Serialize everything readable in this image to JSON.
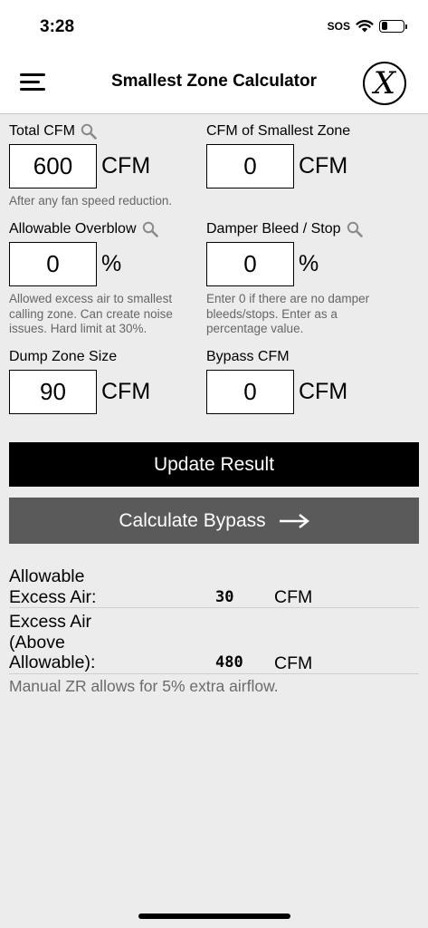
{
  "status_bar": {
    "time": "3:28",
    "sos": "SOS"
  },
  "nav": {
    "title": "Smallest Zone Calculator",
    "logo_text": "X"
  },
  "fields": {
    "total_cfm": {
      "label": "Total CFM",
      "value": "600",
      "unit": "CFM",
      "help": "After any fan speed reduction."
    },
    "smallest_zone": {
      "label": "CFM of Smallest Zone",
      "value": "0",
      "unit": "CFM"
    },
    "allowable_overblow": {
      "label": "Allowable Overblow",
      "value": "0",
      "unit": "%",
      "help": "Allowed excess air to smallest calling zone. Can create noise issues. Hard limit at 30%."
    },
    "damper_bleed": {
      "label": "Damper Bleed / Stop",
      "value": "0",
      "unit": "%",
      "help": "Enter 0 if there are no damper bleeds/stops. Enter as a percentage value."
    },
    "dump_zone": {
      "label": "Dump Zone Size",
      "value": "90",
      "unit": "CFM"
    },
    "bypass_cfm": {
      "label": "Bypass CFM",
      "value": "0",
      "unit": "CFM"
    }
  },
  "buttons": {
    "update": "Update Result",
    "bypass": "Calculate Bypass"
  },
  "results": [
    {
      "label_lines": [
        "Allowable",
        "Excess Air:"
      ],
      "value": "30",
      "unit": "CFM"
    },
    {
      "label_lines": [
        "Excess Air",
        "(Above",
        "Allowable):"
      ],
      "value": "480",
      "unit": "CFM"
    }
  ],
  "note": "Manual ZR allows for 5% extra airflow.",
  "colors": {
    "update_button": "#000000",
    "bypass_button": "#5a5a5a",
    "background": "#ececec",
    "help_text": "#666666"
  },
  "icons": [
    "menu-icon",
    "magnifier-icon",
    "wifi-icon",
    "battery-icon",
    "arrow-right-icon"
  ],
  "battery_level": 0.3
}
